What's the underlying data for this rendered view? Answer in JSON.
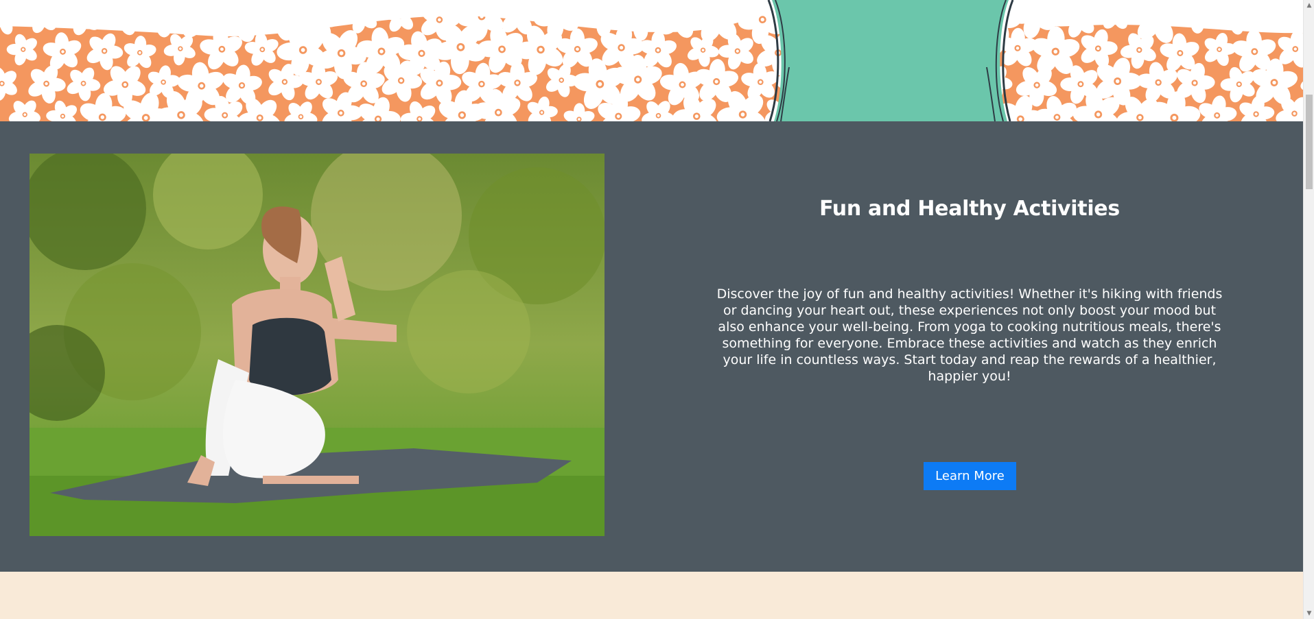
{
  "feature": {
    "title": "Fun and Healthy Activities",
    "body": "Discover the joy of fun and healthy activities! Whether it's hiking with friends or dancing your heart out, these experiences not only boost your mood but also enhance your well-being. From yoga to cooking nutritious meals, there's something for everyone. Embrace these activities and watch as they enrich your life in countless ways. Start today and reap the rewards of a healthier, happier you!",
    "button_label": "Learn More"
  },
  "colors": {
    "banner_orange": "#f4975f",
    "banner_teal": "#6bc6ab",
    "feature_bg": "#4e5961",
    "button_blue": "#0d7bf5",
    "cream_bg": "#f9ead8"
  },
  "icons": {
    "scroll_up": "▲",
    "scroll_down": "▼"
  }
}
